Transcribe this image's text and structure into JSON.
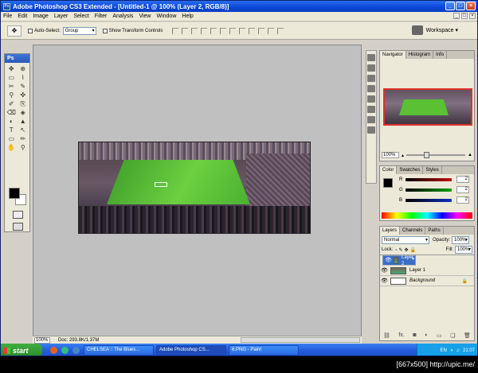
{
  "window": {
    "title": "Adobe Photoshop CS3 Extended - [Untitled-1 @ 100% (Layer 2, RGB/8)]",
    "app_icon": "Ps",
    "minimize": "_",
    "maximize": "□",
    "close": "×"
  },
  "menu": [
    "File",
    "Edit",
    "Image",
    "Layer",
    "Select",
    "Filter",
    "Analysis",
    "View",
    "Window",
    "Help"
  ],
  "options_bar": {
    "auto_select_label": "Auto-Select:",
    "auto_select_value": "Group",
    "show_transform_label": "Show Transform Controls",
    "workspace_label": "Workspace ▾"
  },
  "toolbox": {
    "title": "Ps",
    "tools": [
      "✥",
      "⊕",
      "▭",
      "⌇",
      "✂",
      "✎",
      "⚲",
      "✜",
      "✐",
      "⎘",
      "⌫",
      "◈",
      "◐",
      "▲",
      "✏",
      "T",
      "↖",
      "▭",
      "✋",
      "⚲"
    ]
  },
  "statusbar": {
    "zoom": "100%",
    "doc_info": "Doc: 293.8K/1.37M"
  },
  "navigator": {
    "tabs": [
      "Navigator",
      "Histogram",
      "Info"
    ],
    "zoom": "100%"
  },
  "color_panel": {
    "tabs": [
      "Color",
      "Swatches",
      "Styles"
    ],
    "channels": [
      {
        "name": "R",
        "value": "2",
        "color": "#c01010"
      },
      {
        "name": "G",
        "value": "2",
        "color": "#10a010"
      },
      {
        "name": "B",
        "value": "2",
        "color": "#1030c0"
      }
    ]
  },
  "layers_panel": {
    "tabs": [
      "Layers",
      "Channels",
      "Paths"
    ],
    "blend_mode": "Normal",
    "opacity_label": "Opacity:",
    "opacity": "100%",
    "lock_label": "Lock:",
    "fill_label": "Fill:",
    "fill": "100%",
    "layers": [
      {
        "name": "Layer 2",
        "selected": true
      },
      {
        "name": "Layer 1",
        "selected": false
      },
      {
        "name": "Background",
        "selected": false
      }
    ]
  },
  "taskbar": {
    "start": "start",
    "tasks": [
      "CHELSEA :: The Blues...",
      "Adobe Photoshop CS...",
      "6.PNG - Paint"
    ],
    "lang": "EN",
    "time": "21:07"
  },
  "footer": "[667x500] http://upic.me/"
}
